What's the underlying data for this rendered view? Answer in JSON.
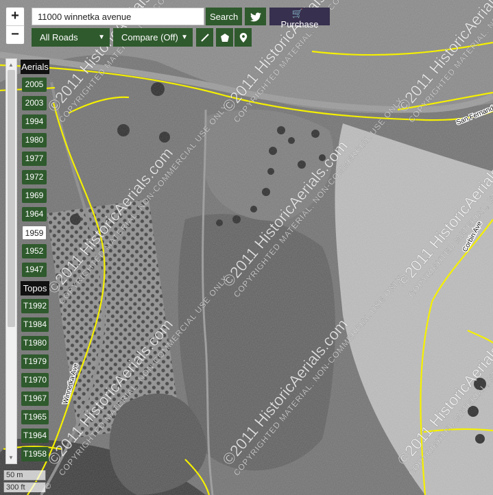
{
  "search": {
    "value": "11000 winnetka avenue",
    "button_label": "Search"
  },
  "purchase_label": "Purchase",
  "zoom": {
    "in_label": "+",
    "out_label": "−"
  },
  "roads_select": {
    "label": "All Roads"
  },
  "compare_select": {
    "label": "Compare (Off)"
  },
  "aerials": {
    "heading": "Aerials",
    "years": [
      "2005",
      "2003",
      "1994",
      "1980",
      "1977",
      "1972",
      "1969",
      "1964",
      "1959",
      "1952",
      "1947"
    ],
    "active_year": "1959"
  },
  "topos": {
    "heading": "Topos",
    "years": [
      "T1992",
      "T1984",
      "T1980",
      "T1979",
      "T1970",
      "T1967",
      "T1965",
      "T1964",
      "T1958"
    ]
  },
  "scale": {
    "metric": "50 m",
    "imperial": "300 ft"
  },
  "attribution": "©",
  "watermark": {
    "big": "©2011 HistoricAerials.com",
    "small": "COPYRIGHTED MATERIAL, NON-COMMERCIAL USE ONLY"
  },
  "streets": {
    "san_fernando": "San Fernando",
    "corbin": "Corbin Ave",
    "winnetka": "Winnetka Ave"
  },
  "colors": {
    "button_green": "#2f5a2d",
    "purchase_purple": "#37304e",
    "road_yellow": "#f5f000"
  }
}
